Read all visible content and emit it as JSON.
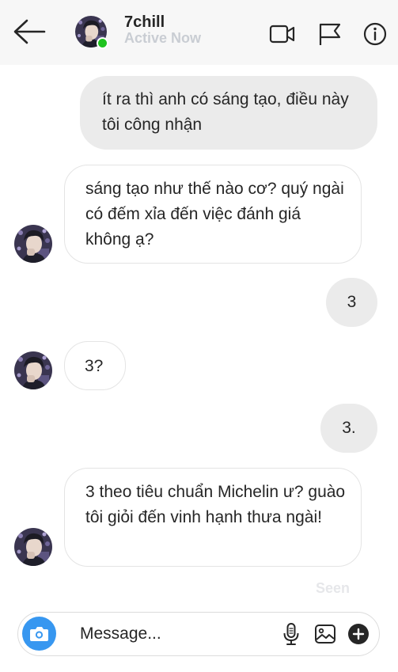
{
  "header": {
    "name": "7chill",
    "status": "Active Now"
  },
  "messages": [
    {
      "side": "out",
      "text": "ít ra thì anh có sáng tạo, điều này tôi công nhận"
    },
    {
      "side": "in",
      "text": "sáng tạo như thế nào cơ? quý ngài có đếm xỉa đến việc đánh giá không ạ?"
    },
    {
      "side": "out",
      "text": "3"
    },
    {
      "side": "in",
      "text": "3?"
    },
    {
      "side": "out",
      "text": "3."
    },
    {
      "side": "in",
      "text": "3 theo tiêu chuẩn Michelin ư? guào tôi giỏi đến vinh hạnh thưa ngài!"
    }
  ],
  "seen_label": "Seen",
  "composer": {
    "placeholder": "Message..."
  },
  "colors": {
    "accent": "#3797f0",
    "online": "#1fc31f",
    "outgoing_bubble": "#ebebeb"
  },
  "icons": [
    "back-arrow-icon",
    "video-camera-icon",
    "flag-icon",
    "info-icon",
    "camera-icon",
    "microphone-icon",
    "image-icon",
    "plus-icon"
  ]
}
